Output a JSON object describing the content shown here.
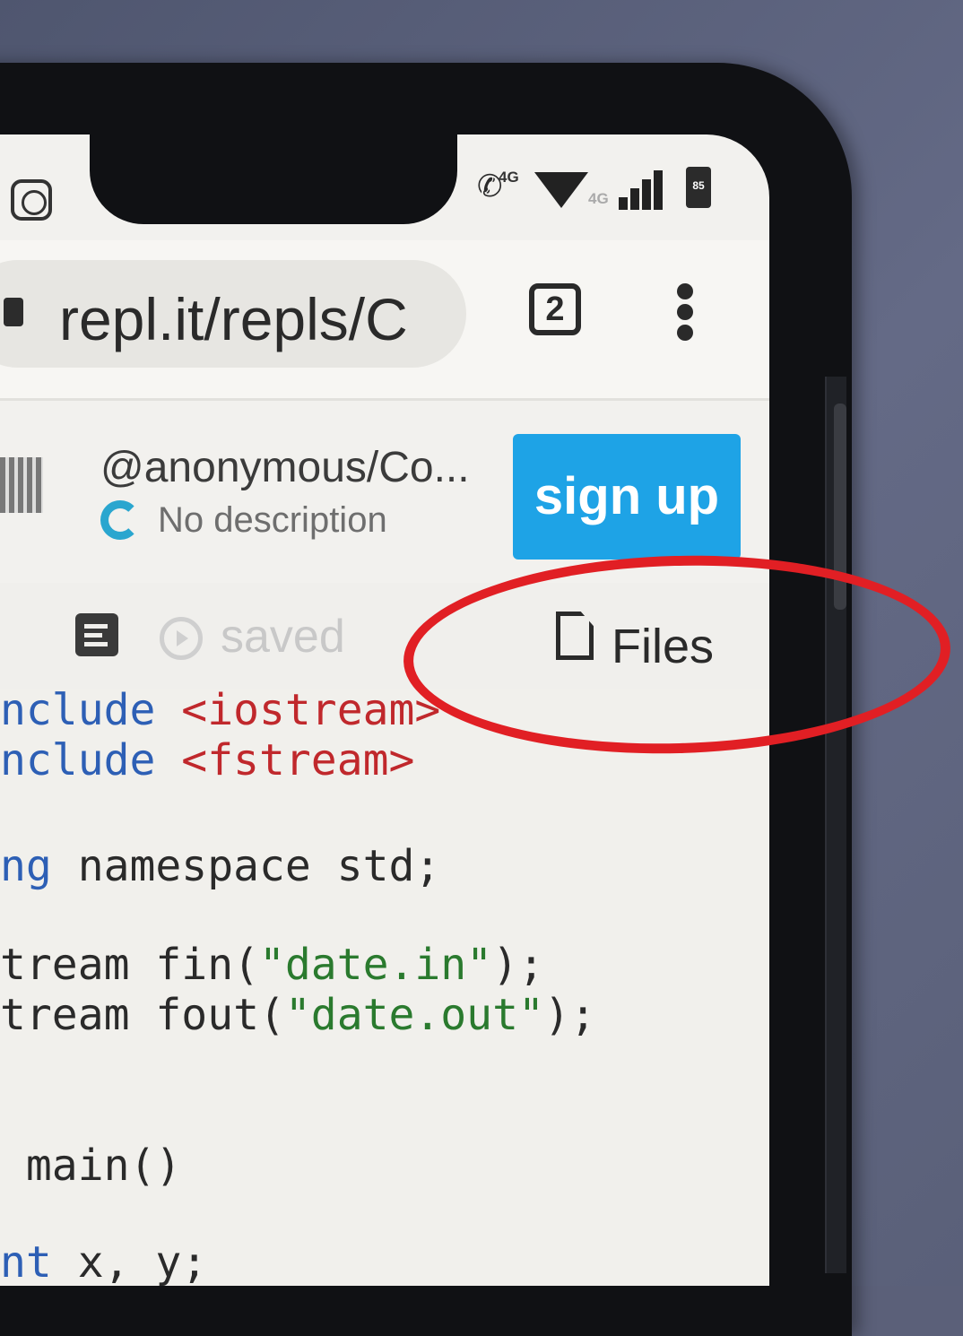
{
  "status_bar": {
    "call_icon": "wifi-call-icon",
    "call_tag": "4G",
    "signal_tag": "4G",
    "battery_level": "85"
  },
  "browser": {
    "url": "repl.it/repls/C",
    "tab_count": "2"
  },
  "repl": {
    "title": "@anonymous/Co...",
    "description": "No description",
    "signup_label": "sign up"
  },
  "toolbar": {
    "saved_label": "saved",
    "files_label": "Files"
  },
  "editor": {
    "lines": [
      [
        {
          "t": "nclude ",
          "c": "kw"
        },
        {
          "t": "<iostream>",
          "c": "str"
        }
      ],
      [
        {
          "t": "nclude ",
          "c": "kw"
        },
        {
          "t": "<fstream>",
          "c": "str"
        }
      ],
      [
        {
          "t": "ng",
          "c": "kw"
        },
        {
          "t": " namespace std;",
          "c": ""
        }
      ],
      [
        {
          "t": "tream fin(",
          "c": ""
        },
        {
          "t": "\"date.in\"",
          "c": "lit"
        },
        {
          "t": ");",
          "c": ""
        }
      ],
      [
        {
          "t": "tream fout(",
          "c": ""
        },
        {
          "t": "\"date.out\"",
          "c": "lit"
        },
        {
          "t": ");",
          "c": ""
        }
      ],
      [
        {
          "t": " main()",
          "c": ""
        }
      ],
      [
        {
          "t": "nt",
          "c": "kw"
        },
        {
          "t": " x, y;",
          "c": ""
        }
      ]
    ]
  },
  "annotation_color": "#e11f24"
}
